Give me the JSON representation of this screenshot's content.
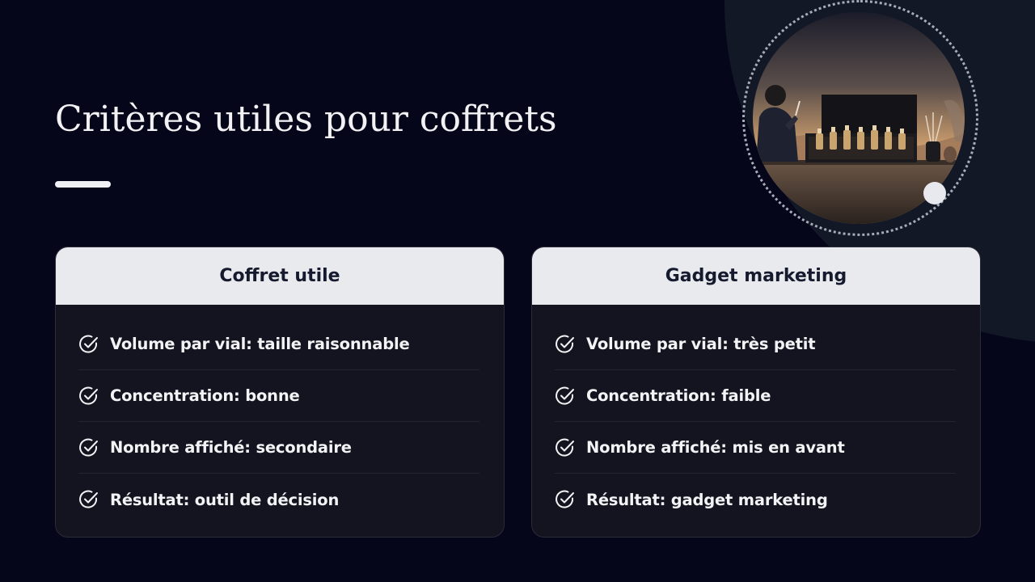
{
  "slide": {
    "title": "Critères utiles pour coffrets"
  },
  "illustration": {
    "icon": "perfume-coffret-illustration"
  },
  "cards": {
    "left": {
      "header": "Coffret utile",
      "items": [
        "Volume par vial: taille raisonnable",
        "Concentration: bonne",
        "Nombre affiché: secondaire",
        "Résultat: outil de décision"
      ]
    },
    "right": {
      "header": "Gadget marketing",
      "items": [
        "Volume par vial: très petit",
        "Concentration: faible",
        "Nombre affiché: mis en avant",
        "Résultat: gadget marketing"
      ]
    }
  },
  "colors": {
    "background": "#05061a",
    "arc": "#131827",
    "card_body": "#13141f",
    "card_header": "#e9eaee",
    "text_light": "#f3f3f6",
    "text_dark": "#161a2e"
  }
}
